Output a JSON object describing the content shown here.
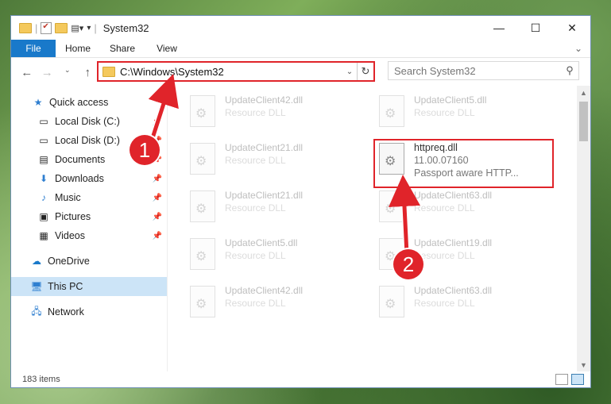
{
  "window": {
    "title": "System32"
  },
  "ribbon": {
    "file": "File",
    "home": "Home",
    "share": "Share",
    "view": "View"
  },
  "address": {
    "path": "C:\\Windows\\System32"
  },
  "search": {
    "placeholder": "Search System32"
  },
  "sidebar": {
    "quick_access": "Quick access",
    "items": [
      {
        "label": "Local Disk (C:)",
        "icon": "drive-icon",
        "pinned": true
      },
      {
        "label": "Local Disk (D:)",
        "icon": "drive-icon",
        "pinned": true
      },
      {
        "label": "Documents",
        "icon": "documents-icon",
        "pinned": true
      },
      {
        "label": "Downloads",
        "icon": "downloads-icon",
        "pinned": true
      },
      {
        "label": "Music",
        "icon": "music-icon",
        "pinned": true
      },
      {
        "label": "Pictures",
        "icon": "pictures-icon",
        "pinned": true
      },
      {
        "label": "Videos",
        "icon": "videos-icon",
        "pinned": true
      }
    ],
    "onedrive": "OneDrive",
    "this_pc": "This PC",
    "network": "Network"
  },
  "files": [
    {
      "name": "UpdateClient42.dll",
      "type": "Resource DLL"
    },
    {
      "name": "UpdateClient5.dll",
      "type": "Resource DLL"
    },
    {
      "name": "UpdateClient21.dll",
      "type": "Resource DLL"
    },
    {
      "name": "httpreq.dll",
      "version": "11.00.07160",
      "desc": "Passport aware HTTP..."
    },
    {
      "name": "UpdateClient21.dll",
      "type": "Resource DLL"
    },
    {
      "name": "UpdateClient63.dll",
      "type": "Resource DLL"
    },
    {
      "name": "UpdateClient5.dll",
      "type": "Resource DLL"
    },
    {
      "name": "UpdateClient19.dll",
      "type": "Resource DLL"
    },
    {
      "name": "UpdateClient42.dll",
      "type": "Resource DLL"
    },
    {
      "name": "UpdateClient63.dll",
      "type": "Resource DLL"
    }
  ],
  "annotations": {
    "step1": "1",
    "step2": "2"
  },
  "status": {
    "count": "183 items"
  },
  "colors": {
    "accent": "#1979ca",
    "highlight": "#e0242a"
  }
}
